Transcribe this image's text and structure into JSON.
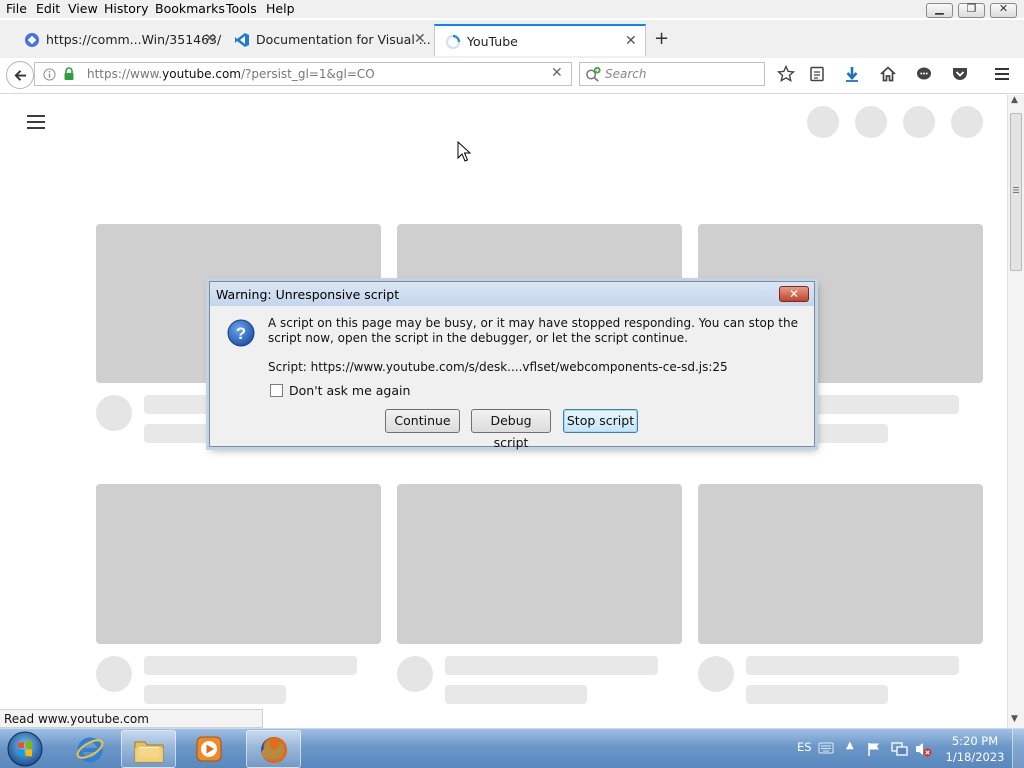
{
  "menubar": {
    "items": [
      "File",
      "Edit",
      "View",
      "History",
      "Bookmarks",
      "Tools",
      "Help"
    ]
  },
  "tabs": [
    {
      "title": "https://comm...Win/351463/",
      "favicon": "blue-diamond-icon"
    },
    {
      "title": "Documentation for Visual ...",
      "favicon": "vscode-icon"
    },
    {
      "title": "YouTube",
      "favicon": "loading-spinner-icon",
      "active": true
    }
  ],
  "navbar": {
    "url_prefix": "https://www.",
    "url_domain": "youtube.com",
    "url_path": "/?persist_gl=1&gl=CO",
    "search_placeholder": "Search"
  },
  "statusbar": {
    "text": "Read www.youtube.com"
  },
  "dialog": {
    "title": "Warning: Unresponsive script",
    "message": "A script on this page may be busy, or it may have stopped responding. You can stop the script now, open the script in the debugger, or let the script continue.",
    "script": "Script: https://www.youtube.com/s/desk....vflset/webcomponents-ce-sd.js:25",
    "checkbox_label": "Don't ask me again",
    "checkbox_checked": false,
    "buttons": {
      "continue": "Continue",
      "debug": "Debug script",
      "stop": "Stop script"
    },
    "close_symbol": "✕"
  },
  "taskbar": {
    "apps": [
      "internet-explorer-icon",
      "file-explorer-icon",
      "media-player-icon",
      "firefox-icon"
    ],
    "language": "ES",
    "time": "5:20 PM",
    "date": "1/18/2023"
  },
  "colors": {
    "tab_accent": "#0a84ff",
    "skeleton": "#cfcfcf",
    "skeleton_light": "#e8e8e8",
    "taskbar": "#6b97c8"
  }
}
